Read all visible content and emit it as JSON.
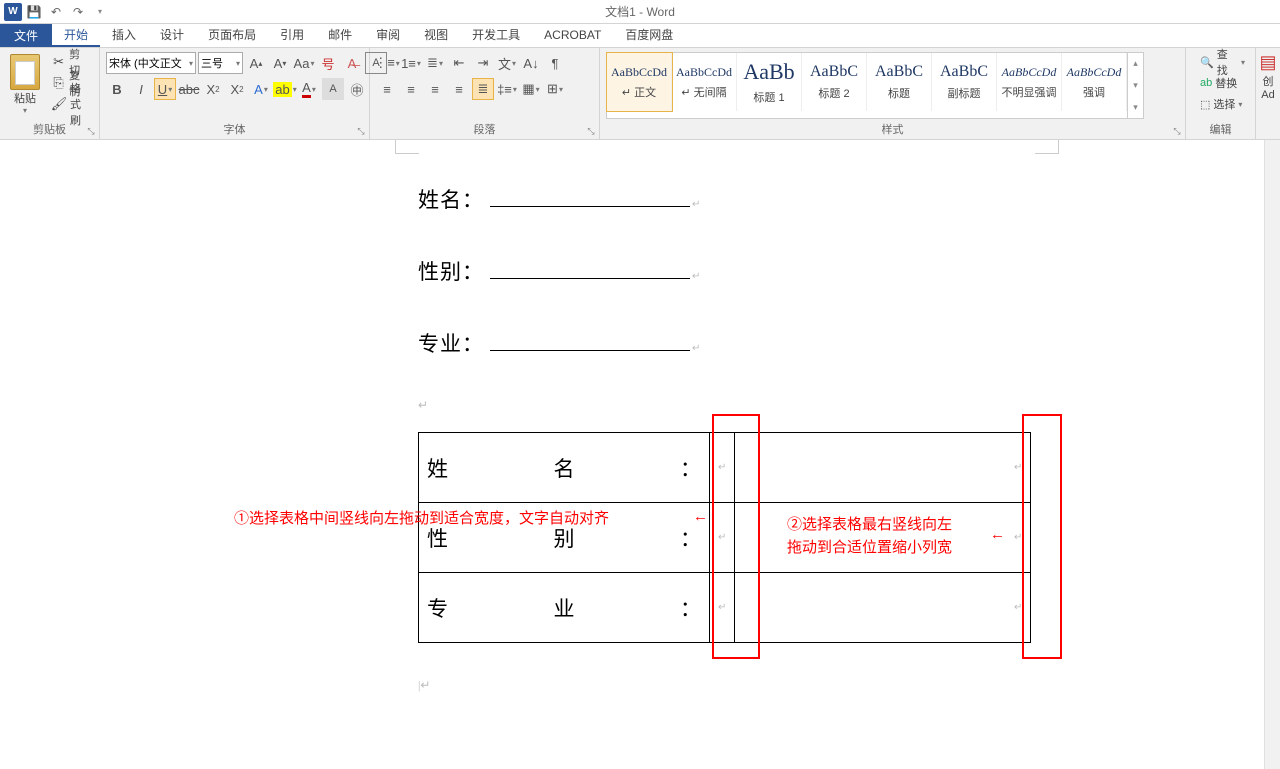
{
  "title": "文档1 - Word",
  "tabs": {
    "file": "文件",
    "home": "开始",
    "insert": "插入",
    "design": "设计",
    "layout": "页面布局",
    "references": "引用",
    "mailings": "邮件",
    "review": "审阅",
    "view": "视图",
    "developer": "开发工具",
    "acrobat": "ACROBAT",
    "baidu": "百度网盘"
  },
  "groups": {
    "clipboard": "剪贴板",
    "font": "字体",
    "paragraph": "段落",
    "styles": "样式",
    "editing": "编辑"
  },
  "clipboard": {
    "paste": "粘贴",
    "cut": "剪切",
    "copy": "复制",
    "format_painter": "格式刷"
  },
  "font": {
    "name": "宋体 (中文正文",
    "size": "三号"
  },
  "styles": [
    {
      "preview": "AaBbCcDd",
      "label": "↵ 正文",
      "size": "12px"
    },
    {
      "preview": "AaBbCcDd",
      "label": "↵ 无间隔",
      "size": "12px"
    },
    {
      "preview": "AaBb",
      "label": "标题 1",
      "size": "22px"
    },
    {
      "preview": "AaBbC",
      "label": "标题 2",
      "size": "16px"
    },
    {
      "preview": "AaBbC",
      "label": "标题",
      "size": "16px"
    },
    {
      "preview": "AaBbC",
      "label": "副标题",
      "size": "16px"
    },
    {
      "preview": "AaBbCcDd",
      "label": "不明显强调",
      "size": "12px",
      "italic": true
    },
    {
      "preview": "AaBbCcDd",
      "label": "强调",
      "size": "12px",
      "italic": true
    }
  ],
  "editing": {
    "find": "查找",
    "replace": "替换",
    "select": "选择"
  },
  "document": {
    "field1": "姓名：",
    "field2": "性别：",
    "field3": "专业：",
    "table_r1_a": "姓",
    "table_r1_b": "名",
    "table_r1_c": "：",
    "table_r2_a": "性",
    "table_r2_b": "别",
    "table_r2_c": "：",
    "table_r3_a": "专",
    "table_r3_b": "业",
    "table_r3_c": "："
  },
  "annotations": {
    "a1": "①选择表格中间竖线向左拖动到适合宽度，文字自动对齐",
    "a2_l1": "②选择表格最右竖线向左",
    "a2_l2": "拖动到合适位置缩小列宽"
  },
  "extra": {
    "create": "创",
    "ad": "Ad"
  }
}
